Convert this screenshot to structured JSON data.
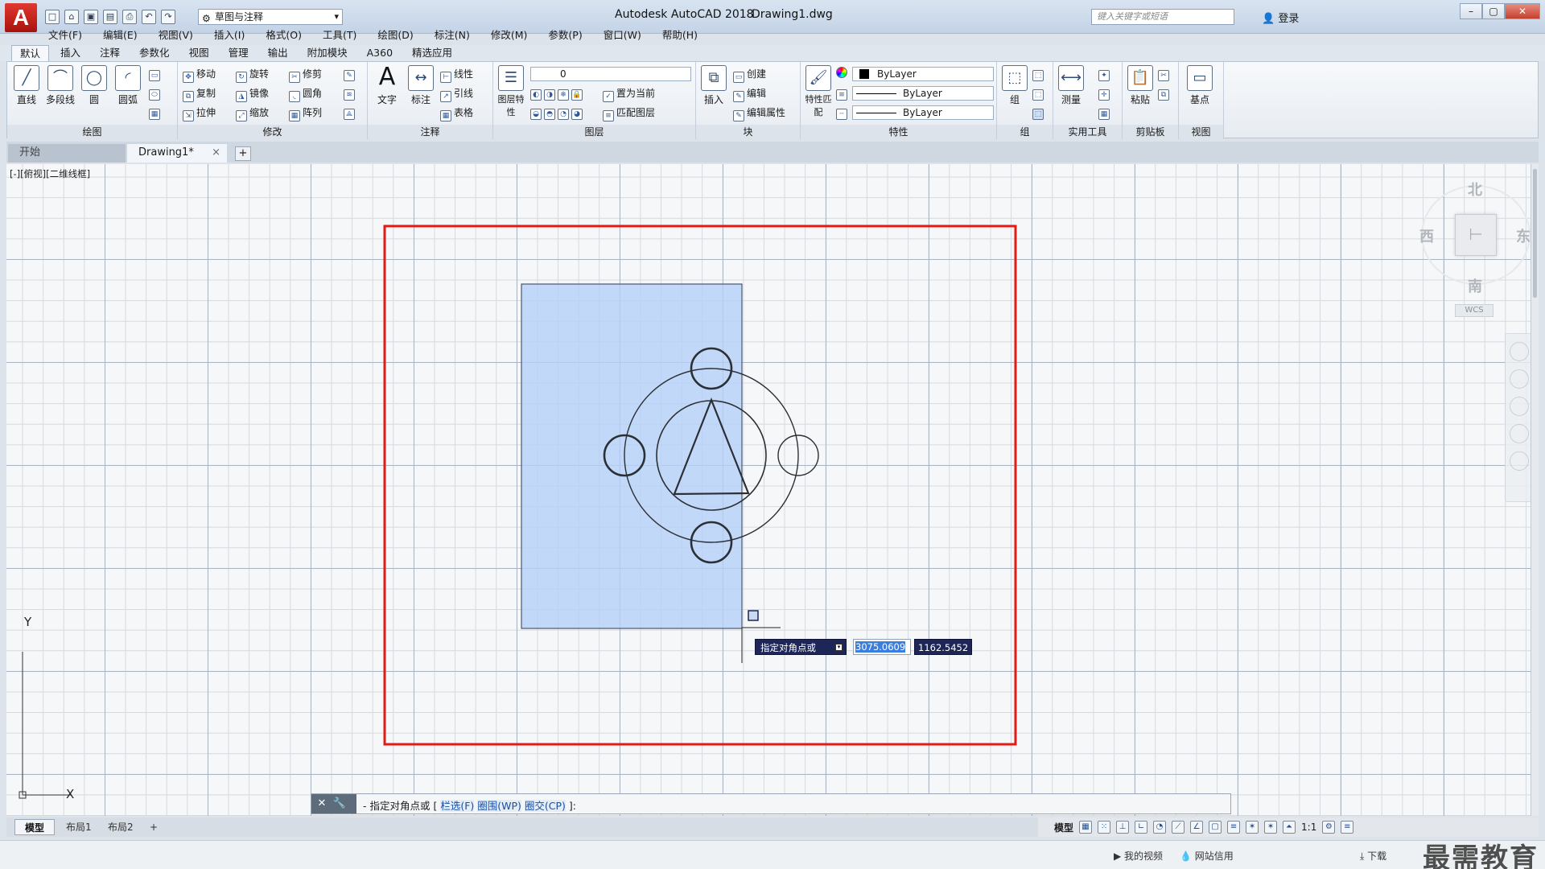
{
  "titlebar": {
    "app_logo": "A",
    "workspace": "草图与注释",
    "title": "Autodesk AutoCAD 2018",
    "file": "Drawing1.dwg",
    "search_placeholder": "键入关键字或短语",
    "login": "登录"
  },
  "menu": [
    "文件(F)",
    "编辑(E)",
    "视图(V)",
    "插入(I)",
    "格式(O)",
    "工具(T)",
    "绘图(D)",
    "标注(N)",
    "修改(M)",
    "参数(P)",
    "窗口(W)",
    "帮助(H)"
  ],
  "ribbon_tabs": [
    "默认",
    "插入",
    "注释",
    "参数化",
    "视图",
    "管理",
    "输出",
    "附加模块",
    "A360",
    "精选应用"
  ],
  "ribbon": {
    "draw": {
      "title": "绘图",
      "line": "直线",
      "polyline": "多段线",
      "circle": "圆",
      "arc": "圆弧"
    },
    "modify": {
      "title": "修改",
      "move": "移动",
      "rotate": "旋转",
      "trim": "修剪",
      "copy": "复制",
      "mirror": "镜像",
      "fillet": "圆角",
      "stretch": "拉伸",
      "scale": "缩放",
      "array": "阵列"
    },
    "annotation": {
      "title": "注释",
      "text": "文字",
      "dimension": "标注",
      "linear": "线性",
      "leader": "引线",
      "table": "表格"
    },
    "layers": {
      "title": "图层",
      "layer_props": "图层特性",
      "current_layer": "0",
      "set_current": "置为当前",
      "match_layer": "匹配图层"
    },
    "block": {
      "title": "块",
      "insert": "插入",
      "create": "创建",
      "edit": "编辑",
      "edit_attr": "编辑属性"
    },
    "properties": {
      "title": "特性",
      "match": "特性匹配",
      "color": "ByLayer",
      "linetype": "ByLayer",
      "lineweight": "ByLayer"
    },
    "groups": {
      "title": "组",
      "group": "组"
    },
    "utilities": {
      "title": "实用工具",
      "measure": "测量"
    },
    "clipboard": {
      "title": "剪贴板",
      "paste": "粘贴"
    },
    "view": {
      "title": "视图",
      "base": "基点"
    }
  },
  "doc_tabs": {
    "start": "开始",
    "drawing": "Drawing1*"
  },
  "viewport_label": "[-][俯视][二维线框]",
  "viewcube": {
    "north": "北",
    "south": "南",
    "east": "东",
    "west": "西",
    "wcs": "WCS"
  },
  "dynamic_input": {
    "prompt": "指定对角点或",
    "x_value": "3075.0609",
    "y_value": "1162.5452"
  },
  "command_line": {
    "prefix": "- 指定对角点或 [",
    "opt1": "栏选(F)",
    "opt2": "圈围(WP)",
    "opt3": "圈交(CP)",
    "suffix": "]:"
  },
  "ucs": {
    "x": "X",
    "y": "Y"
  },
  "layout_tabs": [
    "模型",
    "布局1",
    "布局2"
  ],
  "status": {
    "model": "模型",
    "scale": "1:1"
  },
  "taskbar": {
    "video": "我的视频",
    "credit": "网站信用",
    "download": "下载"
  },
  "watermark": "最需教育"
}
